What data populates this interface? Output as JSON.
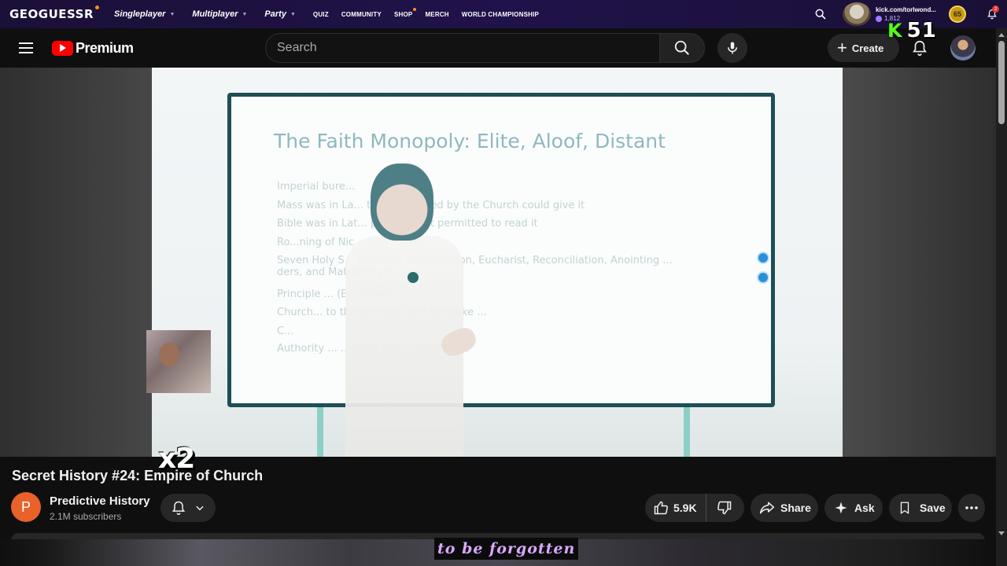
{
  "geoguessr": {
    "logo": "GEOGUESSR",
    "nav_main": [
      "Singleplayer",
      "Multiplayer",
      "Party"
    ],
    "nav_small": [
      "QUIZ",
      "COMMUNITY",
      "SHOP",
      "MERCH",
      "WORLD CHAMPIONSHIP"
    ],
    "user_name": "kick.com/torlwond...",
    "coins": "1,812",
    "level": "65",
    "notification_count": "2"
  },
  "kick_overlay": {
    "k": "K",
    "number": "51"
  },
  "youtube_header": {
    "logo_text": "Premium",
    "search_placeholder": "Search",
    "create_label": "Create"
  },
  "video": {
    "slide_title": "The Faith Monopoly:  Elite, Aloof, Distant",
    "slide_bullets": [
      "Imperial bure...",
      "Mass was in La...         those ordained by the Church could give it",
      "Bible was in Lat...         ple were not permitted to read it",
      "Ro...ning of Nic...         Holy Trinity)",
      "Seven Holy S...         Baptism, Confirmation, Eucharist, Reconciliation, Anointing ...         ders, and Matrimony)",
      "Principle ...         (Eucharist)",
      "Church...         to think, to act, and to shake ...",
      "C...",
      "Authority ...         ... were the ... rather to..."
    ],
    "overlay_multiplier": "x2"
  },
  "info": {
    "title": "Secret History #24: Empire of Church",
    "channel_initial": "P",
    "channel_name": "Predictive History",
    "subscribers": "2.1M subscribers",
    "likes": "5.9K",
    "share_label": "Share",
    "ask_label": "Ask",
    "save_label": "Save"
  },
  "caption": "to be forgotten",
  "colors": {
    "yt_red": "#ff0000",
    "geo_bar": "#20124a",
    "kick_green": "#53fc18",
    "caption_text": "#d8a8ff",
    "channel_avatar": "#e8622a"
  }
}
